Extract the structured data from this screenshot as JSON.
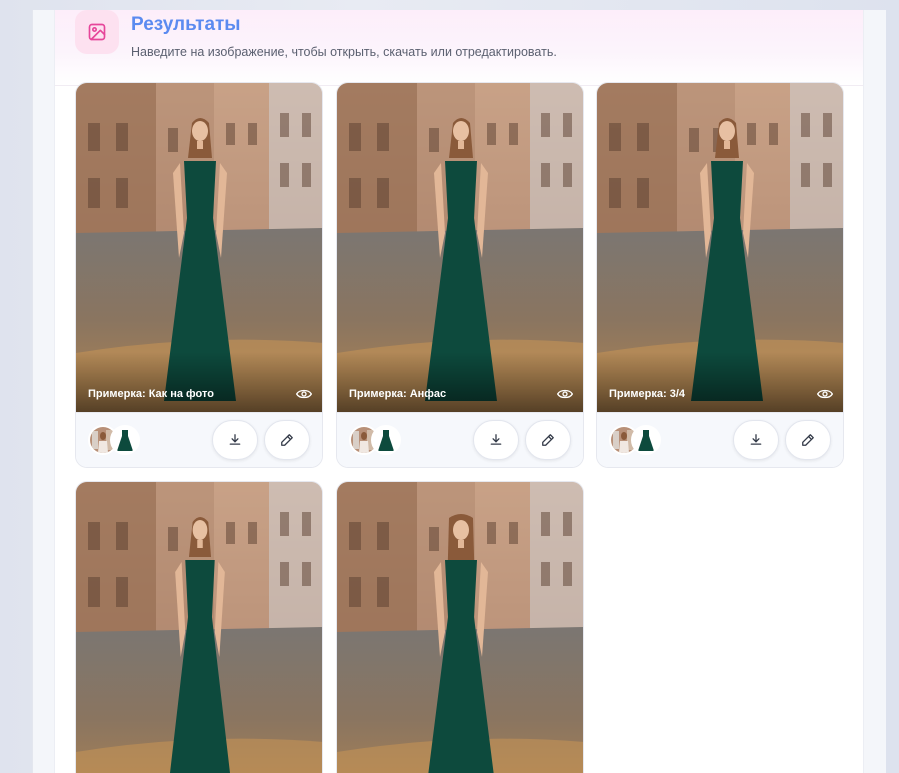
{
  "header": {
    "title": "Результаты",
    "subtitle": "Наведите на изображение, чтобы открыть, скачать или отредактировать.",
    "icon": "image-icon"
  },
  "colors": {
    "accent": "#5b8bf0",
    "icon_bg": "#fde1f0",
    "icon_fg": "#e6459a",
    "dress": "#0d4a3d"
  },
  "results": [
    {
      "caption": "Примерка: Как на фото",
      "pose": "front"
    },
    {
      "caption": "Примерка: Анфас",
      "pose": "front"
    },
    {
      "caption": "Примерка: 3/4",
      "pose": "three-quarter"
    },
    {
      "caption": "",
      "pose": "side"
    },
    {
      "caption": "",
      "pose": "back"
    }
  ],
  "actions": {
    "download_icon": "download-icon",
    "edit_icon": "pencil-icon",
    "view_icon": "eye-icon"
  }
}
